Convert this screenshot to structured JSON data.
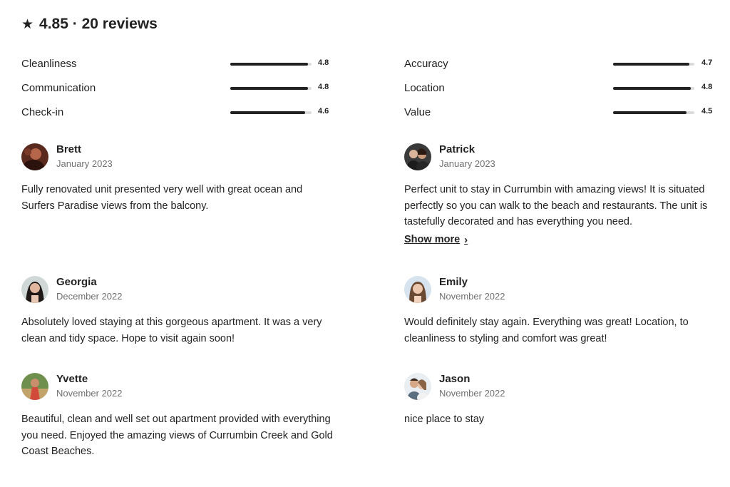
{
  "summary": {
    "star_icon": "★",
    "text": "4.85 · 20 reviews"
  },
  "categories": [
    {
      "label": "Cleanliness",
      "score": "4.8",
      "fraction": 0.96
    },
    {
      "label": "Communication",
      "score": "4.8",
      "fraction": 0.96
    },
    {
      "label": "Check-in",
      "score": "4.6",
      "fraction": 0.92
    },
    {
      "label": "Accuracy",
      "score": "4.7",
      "fraction": 0.94
    },
    {
      "label": "Location",
      "score": "4.8",
      "fraction": 0.96
    },
    {
      "label": "Value",
      "score": "4.5",
      "fraction": 0.9
    }
  ],
  "reviews": [
    {
      "name": "Brett",
      "date": "January 2023",
      "text": "Fully renovated unit presented very well with great ocean and Surfers Paradise views from the balcony."
    },
    {
      "name": "Patrick",
      "date": "January 2023",
      "text": "Perfect unit to stay in Currumbin with amazing views! It is situated perfectly so you can walk to the beach and restaurants. The unit is tastefully decorated and has everything you need.",
      "show_more": "Show more",
      "show_more_icon": "›"
    },
    {
      "name": "Georgia",
      "date": "December 2022",
      "text": "Absolutely loved staying at this gorgeous apartment. It was a very clean and tidy space. Hope to visit again soon!"
    },
    {
      "name": "Emily",
      "date": "November 2022",
      "text": "Would definitely stay again. Everything was great! Location, to cleanliness to styling and comfort was great!"
    },
    {
      "name": "Yvette",
      "date": "November 2022",
      "text": "Beautiful, clean and well set out apartment provided with everything you need. Enjoyed the amazing views of Currumbin Creek and Gold Coast Beaches."
    },
    {
      "name": "Jason",
      "date": "November 2022",
      "text": "nice place to stay"
    }
  ]
}
